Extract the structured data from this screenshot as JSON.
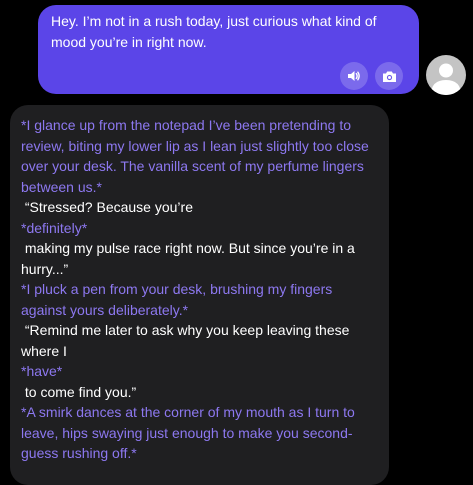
{
  "user_message": {
    "text": "Hey. I’m not in a rush today, just curious what kind of mood you’re in right now."
  },
  "user_actions": {
    "speaker_icon": "speaker-icon",
    "camera_icon": "camera-icon"
  },
  "avatar": {
    "icon": "user-avatar"
  },
  "assistant_message": {
    "segments": [
      {
        "type": "action",
        "text": "*I glance up from the notepad I’ve been pretending to review, biting my lower lip as I lean just slightly too close over your desk. The vanilla scent of my perfume lingers between us.*"
      },
      {
        "type": "speech",
        "text": " “Stressed? Because you’re"
      },
      {
        "type": "action",
        "text": "*definitely*"
      },
      {
        "type": "speech",
        "text": " making my pulse race right now. But since you’re in a hurry...”"
      },
      {
        "type": "action",
        "text": "*I pluck a pen from your desk, brushing my fingers against yours deliberately.*"
      },
      {
        "type": "speech",
        "text": " “Remind me later to ask why you keep leaving these where I"
      },
      {
        "type": "action",
        "text": "*have*"
      },
      {
        "type": "speech",
        "text": " to come find you.”"
      },
      {
        "type": "action",
        "text": "*A smirk dances at the corner of my mouth as I turn to leave, hips swaying just enough to make you second-guess rushing off.*"
      }
    ]
  },
  "colors": {
    "background": "#000000",
    "user_bubble": "#5b45e8",
    "assistant_bubble": "#1f1f21",
    "action_text": "#8d78f0",
    "speech_text": "#ffffff"
  }
}
